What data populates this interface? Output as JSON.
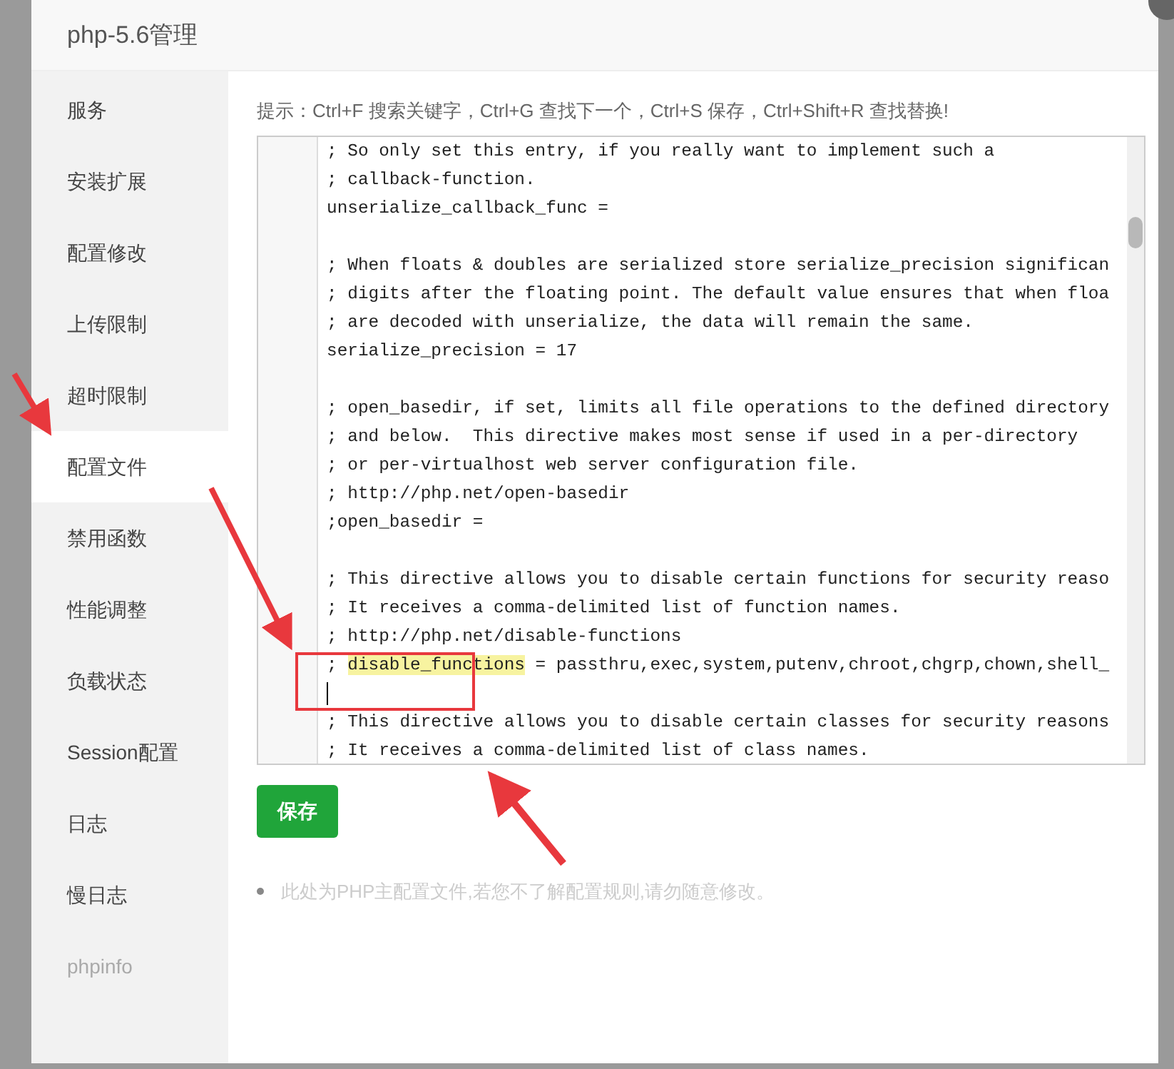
{
  "window": {
    "title": "php-5.6管理"
  },
  "sidebar": {
    "items": [
      {
        "label": "服务",
        "selected": false,
        "disabled": false
      },
      {
        "label": "安装扩展",
        "selected": false,
        "disabled": false
      },
      {
        "label": "配置修改",
        "selected": false,
        "disabled": false
      },
      {
        "label": "上传限制",
        "selected": false,
        "disabled": false
      },
      {
        "label": "超时限制",
        "selected": false,
        "disabled": false
      },
      {
        "label": "配置文件",
        "selected": true,
        "disabled": false
      },
      {
        "label": "禁用函数",
        "selected": false,
        "disabled": false
      },
      {
        "label": "性能调整",
        "selected": false,
        "disabled": false
      },
      {
        "label": "负载状态",
        "selected": false,
        "disabled": false
      },
      {
        "label": "Session配置",
        "selected": false,
        "disabled": false
      },
      {
        "label": "日志",
        "selected": false,
        "disabled": false
      },
      {
        "label": "慢日志",
        "selected": false,
        "disabled": false
      },
      {
        "label": "phpinfo",
        "selected": false,
        "disabled": true
      }
    ]
  },
  "hint": "提示：Ctrl+F 搜索关键字，Ctrl+G 查找下一个，Ctrl+S 保存，Ctrl+Shift+R 查找替换!",
  "editor": {
    "lines": [
      {
        "kind": "text",
        "text": "; So only set this entry, if you really want to implement such a"
      },
      {
        "kind": "text",
        "text": "; callback-function."
      },
      {
        "kind": "text",
        "text": "unserialize_callback_func ="
      },
      {
        "kind": "blank"
      },
      {
        "kind": "text",
        "text": "; When floats & doubles are serialized store serialize_precision significan"
      },
      {
        "kind": "text",
        "text": "; digits after the floating point. The default value ensures that when floa"
      },
      {
        "kind": "text",
        "text": "; are decoded with unserialize, the data will remain the same."
      },
      {
        "kind": "text",
        "text": "serialize_precision = 17"
      },
      {
        "kind": "blank"
      },
      {
        "kind": "text",
        "text": "; open_basedir, if set, limits all file operations to the defined directory"
      },
      {
        "kind": "text",
        "text": "; and below.  This directive makes most sense if used in a per-directory"
      },
      {
        "kind": "text",
        "text": "; or per-virtualhost web server configuration file."
      },
      {
        "kind": "text",
        "text": "; http://php.net/open-basedir"
      },
      {
        "kind": "text",
        "text": ";open_basedir ="
      },
      {
        "kind": "blank"
      },
      {
        "kind": "text",
        "text": "; This directive allows you to disable certain functions for security reaso"
      },
      {
        "kind": "text",
        "text": "; It receives a comma-delimited list of function names."
      },
      {
        "kind": "text",
        "text": "; http://php.net/disable-functions"
      },
      {
        "kind": "match",
        "before": "; ",
        "match": "disable_functions",
        "after": " = passthru,exec,system,putenv,chroot,chgrp,chown,shell_"
      },
      {
        "kind": "cursor"
      },
      {
        "kind": "text",
        "text": "; This directive allows you to disable certain classes for security reasons"
      },
      {
        "kind": "text",
        "text": "; It receives a comma-delimited list of class names."
      }
    ]
  },
  "save_button": "保存",
  "notes": [
    "此处为PHP主配置文件,若您不了解配置规则,请勿随意修改。"
  ]
}
